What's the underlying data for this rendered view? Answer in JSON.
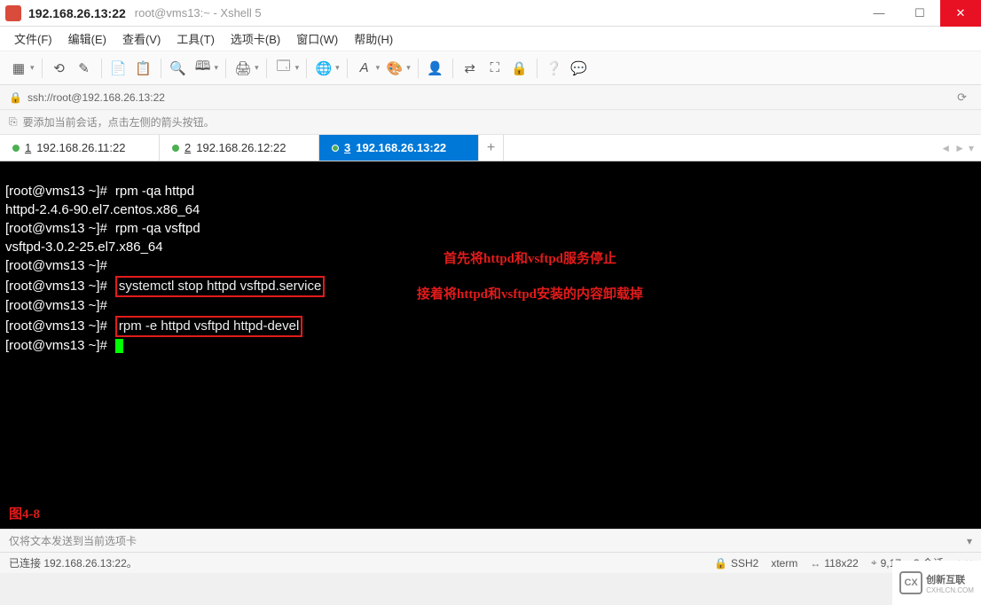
{
  "window": {
    "title_main": "192.168.26.13:22",
    "title_sub": "root@vms13:~ - Xshell 5"
  },
  "menu": {
    "items": [
      "文件(F)",
      "编辑(E)",
      "查看(V)",
      "工具(T)",
      "选项卡(B)",
      "窗口(W)",
      "帮助(H)"
    ]
  },
  "address": {
    "url": "ssh://root@192.168.26.13:22"
  },
  "hint": {
    "text": "要添加当前会话，点击左侧的箭头按钮。"
  },
  "tabs": {
    "items": [
      {
        "num": "1",
        "label": "192.168.26.11:22",
        "active": false
      },
      {
        "num": "2",
        "label": "192.168.26.12:22",
        "active": false
      },
      {
        "num": "3",
        "label": "192.168.26.13:22",
        "active": true
      }
    ]
  },
  "terminal": {
    "prompt": "[root@vms13 ~]#",
    "lines": {
      "l1_cmd": "rpm -qa httpd",
      "l2_out": "httpd-2.4.6-90.el7.centos.x86_64",
      "l3_cmd": "rpm -qa vsftpd",
      "l4_out": "vsftpd-3.0.2-25.el7.x86_64",
      "l6_cmd": "systemctl stop httpd vsftpd.service",
      "l8_cmd": "rpm -e httpd vsftpd httpd-devel"
    },
    "annotations": {
      "a1": "首先将httpd和vsftpd服务停止",
      "a2": "接着将httpd和vsftpd安装的内容卸载掉"
    },
    "figure_label": "图4-8"
  },
  "sendbar": {
    "text": "仅将文本发送到当前选项卡"
  },
  "status": {
    "connection": "已连接 192.168.26.13:22。",
    "ssh": "SSH2",
    "term": "xterm",
    "size": "118x22",
    "pos": "9,17",
    "sessions": "3 会话"
  },
  "watermark": {
    "brand": "创新互联",
    "sub": "CXHLCN.COM"
  }
}
